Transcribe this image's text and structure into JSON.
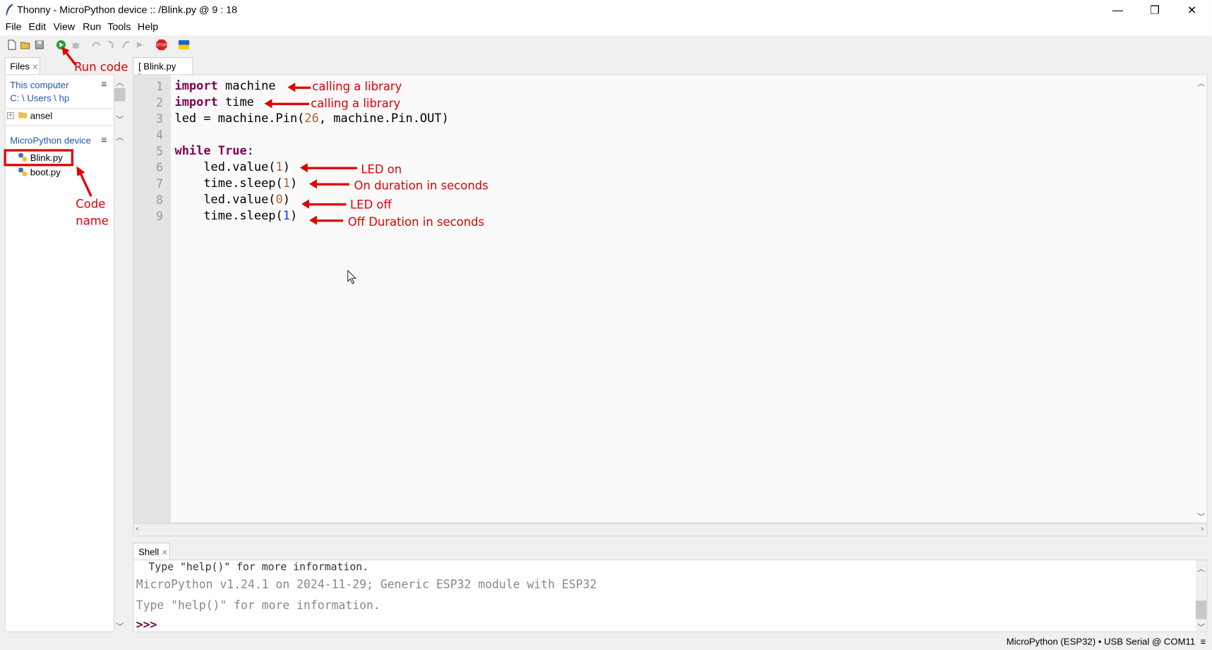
{
  "window": {
    "title": "Thonny  -  MicroPython device :: /Blink.py  @  9 : 18",
    "minimize": "—",
    "maximize": "❐",
    "close": "✕"
  },
  "menu": [
    "File",
    "Edit",
    "View",
    "Run",
    "Tools",
    "Help"
  ],
  "toolbar": {
    "icons": [
      "new-file-icon",
      "open-file-icon",
      "save-icon",
      "run-icon",
      "debug-icon",
      "step-over-icon",
      "step-into-icon",
      "step-out-icon",
      "resume-icon",
      "stop-icon",
      "ukraine-flag-icon"
    ],
    "stop_label": "STOP"
  },
  "files_panel": {
    "tab_label": "Files",
    "this_computer": "This computer",
    "path": "C: \\ Users \\ hp",
    "folder": "ansel",
    "device_label": "MicroPython device",
    "device_files": [
      "Blink.py",
      "boot.py"
    ],
    "menu_glyph": "≡"
  },
  "editor": {
    "tab_label": "[ Blink.py ]",
    "line_numbers": [
      "1",
      "2",
      "3",
      "4",
      "5",
      "6",
      "7",
      "8",
      "9"
    ],
    "lines": [
      "import machine",
      "import time",
      "led = machine.Pin(26, machine.Pin.OUT)",
      "",
      "while True:",
      "    led.value(1)",
      "    time.sleep(1)",
      "    led.value(0)",
      "    time.sleep(1)"
    ]
  },
  "annotations": {
    "run_code": "Run code",
    "code_name_1": "Code",
    "code_name_2": "name",
    "line1": "calling a library",
    "line2": "calling a library",
    "line6": "LED on",
    "line7": "On duration in seconds",
    "line8": "LED off",
    "line9": "Off Duration in seconds"
  },
  "shell": {
    "tab_label": "Shell",
    "lines": [
      "  Type \"help()\" for more information.",
      "MicroPython v1.24.1 on 2024-11-29; Generic ESP32 module with ESP32",
      "Type \"help()\" for more information."
    ],
    "prompt": ">>>"
  },
  "status": {
    "text": "MicroPython (ESP32)  •  USB Serial @ COM11",
    "menu_glyph": "≡"
  },
  "colors": {
    "annotation": "#e00000",
    "keyword": "#7f0055",
    "number": "#b8612a",
    "link_blue": "#2456a8"
  }
}
